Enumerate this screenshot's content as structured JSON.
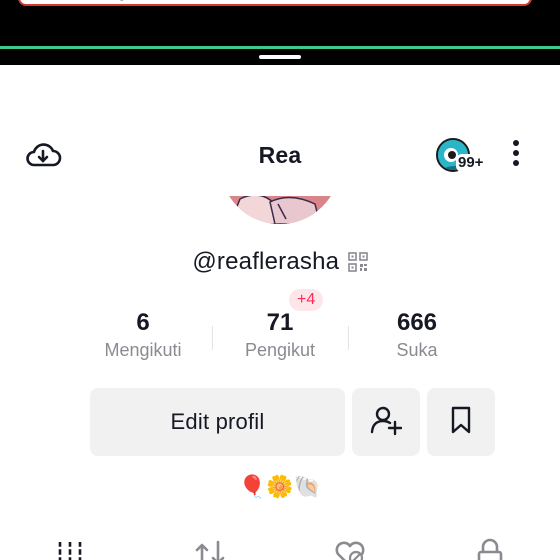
{
  "header": {
    "title": "Rea",
    "notification_count": "99+"
  },
  "profile": {
    "username": "@reaflerasha",
    "new_followers_badge": "+4",
    "bio_emojis": "🎈🌼🐚"
  },
  "stats": [
    {
      "value": "6",
      "label": "Mengikuti"
    },
    {
      "value": "71",
      "label": "Pengikut"
    },
    {
      "value": "666",
      "label": "Suka"
    }
  ],
  "actions": {
    "edit_label": "Edit profil"
  },
  "icons": {
    "cloud": "cloud-download-icon",
    "more": "more-vertical-icon",
    "qr": "qr-code-icon",
    "add_friend": "add-friend-icon",
    "bookmark": "bookmark-icon",
    "tab_videos": "grid-icon",
    "tab_reposts": "repost-icon",
    "tab_liked": "liked-hidden-icon",
    "tab_private": "lock-icon"
  },
  "colors": {
    "accent": "#fe2c55",
    "badge_bg": "#fde6ea",
    "button_bg": "#f1f1f2",
    "muted_text": "#8a8b91",
    "split_line": "#3fc98a"
  }
}
